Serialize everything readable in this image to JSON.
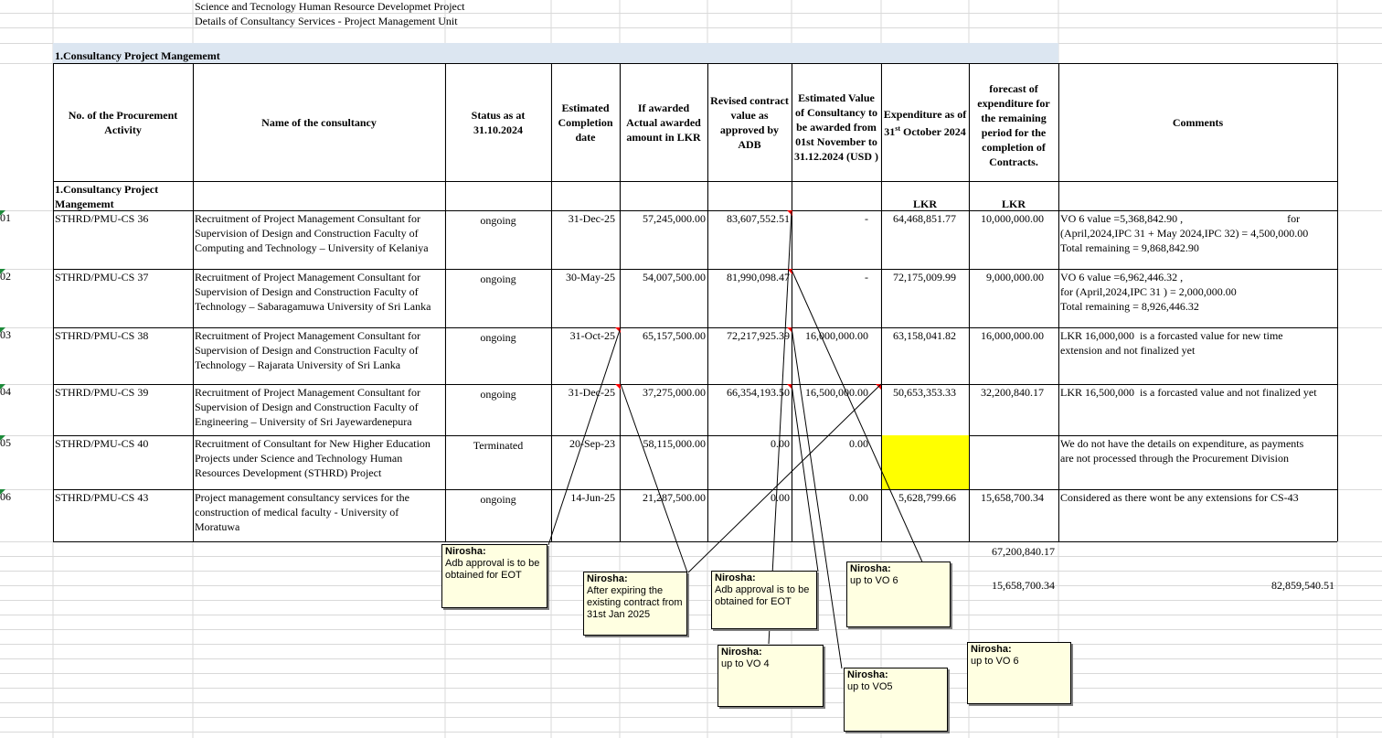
{
  "sheet": {
    "title_line1": "Science and Tecnology Human Resource Developmet Project",
    "title_line2": "Details of Consultancy Services - Project Management Unit",
    "section_title": "1.Consultancy  Project Mangememt"
  },
  "table": {
    "headers": {
      "procurement_no": "No. of the Procurement Activity",
      "name": "Name of the consultancy",
      "status": "Status as at 31.10.2024",
      "completion": "Estimated Completion date",
      "awarded": "If awarded Actual awarded amount in LKR",
      "revised": "Revised contract value as approved by ADB",
      "estimated_value": "Estimated Value of Consultancy to be awarded from 01st November to 31.12.2024 (USD )",
      "expenditure_line1": "Expenditure as of 31",
      "expenditure_sup": "st",
      "expenditure_line2": " October 2024",
      "forecast": "forecast of expenditure for the remaining period for the completion of Contracts.",
      "comments": "Comments"
    },
    "subheader": {
      "label": "1.Consultancy  Project Mangememt",
      "expenditure_unit": "LKR",
      "forecast_unit": "LKR"
    },
    "rows": [
      {
        "row_no": "01",
        "procurement_no": "STHRD/PMU-CS 36",
        "name": "Recruitment of Project Management Consultant for Supervision of Design and Construction Faculty of Computing and Technology – University of Kelaniya",
        "status": "ongoing",
        "completion": "31-Dec-25",
        "awarded": "57,245,000.00",
        "revised": "83,607,552.51",
        "estimated_value": "-",
        "expenditure": "64,468,851.77",
        "forecast": "10,000,000.00",
        "comment_lines": [
          "VO 6 value =5,368,842.90 ,                                      for",
          "(April,2024,IPC 31 + May 2024,IPC 32) = 4,500,000.00",
          "Total remaining = 9,868,842.90"
        ]
      },
      {
        "row_no": "02",
        "procurement_no": "STHRD/PMU-CS 37",
        "name": "Recruitment of Project Management Consultant for Supervision of Design and Construction Faculty of Technology – Sabaragamuwa University of Sri Lanka",
        "status": "ongoing",
        "completion": "30-May-25",
        "awarded": "54,007,500.00",
        "revised": "81,990,098.47",
        "estimated_value": "-",
        "expenditure": "72,175,009.99",
        "forecast": "9,000,000.00",
        "comment_lines": [
          "VO 6 value =6,962,446.32 ,",
          "for (April,2024,IPC 31 ) = 2,000,000.00",
          "Total remaining = 8,926,446.32"
        ]
      },
      {
        "row_no": "03",
        "procurement_no": "STHRD/PMU-CS 38",
        "name": "Recruitment of Project Management Consultant for Supervision of Design and Construction Faculty of Technology – Rajarata University of Sri Lanka",
        "status": "ongoing",
        "completion": "31-Oct-25",
        "awarded": "65,157,500.00",
        "revised": "72,217,925.39",
        "estimated_value": "16,000,000.00",
        "expenditure": "63,158,041.82",
        "forecast": "16,000,000.00",
        "comment_lines": [
          "LKR 16,000,000  is a forcasted value for new time",
          "extension and not finalized yet"
        ]
      },
      {
        "row_no": "04",
        "procurement_no": "STHRD/PMU-CS 39",
        "name": "Recruitment of Project Management Consultant for Supervision of Design and Construction Faculty of Engineering – University of Sri Jayewardenepura",
        "status": "ongoing",
        "completion": "31-Dec-25",
        "awarded": "37,275,000.00",
        "revised": "66,354,193.50",
        "estimated_value": "16,500,000.00",
        "expenditure": "50,653,353.33",
        "forecast": "32,200,840.17",
        "comment_lines": [
          "LKR 16,500,000  is a forcasted value and not finalized yet"
        ]
      },
      {
        "row_no": "05",
        "procurement_no": "STHRD/PMU-CS 40",
        "name": "Recruitment of Consultant for New Higher Education Projects under Science and Technology Human Resources Development (STHRD) Project",
        "status": "Terminated",
        "completion": "20-Sep-23",
        "awarded": "58,115,000.00",
        "revised": "0.00",
        "estimated_value": "0.00",
        "expenditure": "",
        "forecast": "",
        "comment_lines": [
          "We do not have the details on expenditure, as payments",
          "are not processed through the Procurement Division"
        ]
      },
      {
        "row_no": "06",
        "procurement_no": "STHRD/PMU-CS 43",
        "name": "Project management consultancy services for the construction of medical faculty - University of Moratuwa",
        "status": "ongoing",
        "completion": "14-Jun-25",
        "awarded": "21,287,500.00",
        "revised": "0.00",
        "estimated_value": "0.00",
        "expenditure": "5,628,799.66",
        "forecast": "15,658,700.34",
        "comment_lines": [
          "Considered as there wont be any extensions for CS-43"
        ]
      }
    ],
    "totals": {
      "forecast_total": "67,200,840.17",
      "forecast_cs43": "15,658,700.34",
      "grand_total": "82,859,540.51"
    }
  },
  "comments_notes": [
    {
      "author": "Nirosha:",
      "text": "Adb approval is to be obtained for EOT"
    },
    {
      "author": "Nirosha:",
      "text": "After expiring the existing contract from 31st Jan 2025"
    },
    {
      "author": "Nirosha:",
      "text": "Adb approval is to be obtained for EOT"
    },
    {
      "author": "Nirosha:",
      "text": "up to VO 6"
    },
    {
      "author": "Nirosha:",
      "text": "up to VO 4"
    },
    {
      "author": "Nirosha:",
      "text": "up to VO5"
    },
    {
      "author": "Nirosha:",
      "text": "up to VO 6"
    }
  ],
  "colors": {
    "section_band": "#dce6f1",
    "highlight": "#ffff00",
    "note_bg": "#ffffe1",
    "comment_marker": "#ff0000",
    "gridline": "#d9d9d9"
  }
}
